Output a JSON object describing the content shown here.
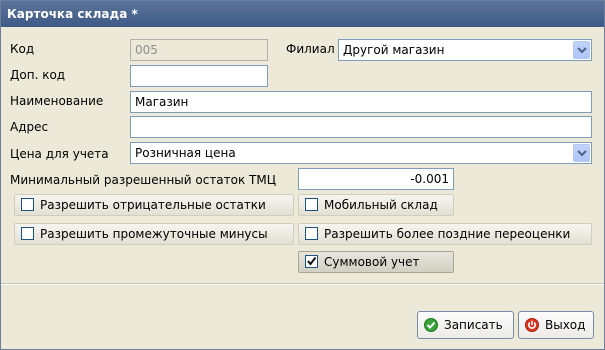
{
  "window": {
    "title": "Карточка склада *"
  },
  "form": {
    "code_label": "Код",
    "code_value": "005",
    "branch_label": "Филиал",
    "branch_value": "Другой магазин",
    "extra_code_label": "Доп. код",
    "extra_code_value": "",
    "name_label": "Наименование",
    "name_value": "Магазин",
    "address_label": "Адрес",
    "address_value": "",
    "price_label": "Цена для учета",
    "price_value": "Розничная цена",
    "min_stock_label": "Минимальный разрешенный остаток ТМЦ",
    "min_stock_value": "-0.001"
  },
  "options": {
    "negative_stock": {
      "label": "Разрешить отрицательные остатки",
      "checked": false
    },
    "mobile_warehouse": {
      "label": "Мобильный склад",
      "checked": false
    },
    "intermediate_minus": {
      "label": "Разрешить промежуточные минусы",
      "checked": false
    },
    "later_revaluation": {
      "label": "Разрешить более поздние переоценки",
      "checked": false
    },
    "sum_accounting": {
      "label": "Суммовой учет",
      "checked": true
    }
  },
  "footer": {
    "save_label": "Записать",
    "exit_label": "Выход"
  },
  "colors": {
    "titlebar": "#4a6690",
    "window_bg": "#ece9d8",
    "save_icon": "#3aa23a",
    "exit_icon": "#d9371f"
  }
}
